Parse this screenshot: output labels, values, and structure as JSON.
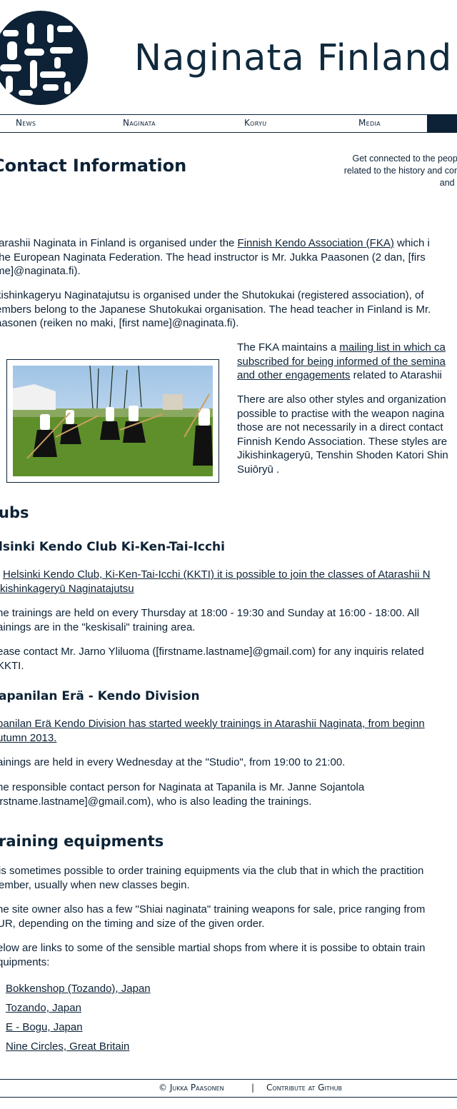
{
  "header": {
    "title": "Naginata Finland",
    "logo_icon": "naginata-kanji-logo"
  },
  "nav": {
    "items": [
      "News",
      "Naginata",
      "Koryu",
      "Media"
    ]
  },
  "page": {
    "title": "Contact Information",
    "intro": [
      "Get connected to the people wh",
      "related to the history and contents",
      "and to Na"
    ]
  },
  "p1": {
    "pre": "tarashii Naginata in Finland is organised under the ",
    "link": "Finnish Kendo Association (FKA)",
    "post": " which i",
    "line2": "the European Naginata Federation. The head instructor is Mr. Jukka Paasonen (2 dan, [firs",
    "line3": "me]@naginata.fi)."
  },
  "p2": {
    "line1": "kishinkageryu Naginatajutsu is organised under the Shutokukai (registered association), of",
    "line2": "embers belong to the Japanese Shutokukai organisation. The head teacher in Finland is Mr.",
    "line3": "aasonen (reiken no maki, [first name]@naginata.fi)."
  },
  "p3": {
    "pre": "The FKA maintains a ",
    "link1": "mailing list in which ca",
    "link2": "subscribed for being informed of the semina",
    "link3": "and other engagements",
    "post": " related to Atarashii"
  },
  "p4": [
    "There are also other styles and organization",
    "possible to practise with the weapon nagina",
    "those are not necessarily in a direct contact",
    "Finnish Kendo Association. These styles are",
    "Jikishinkageryū, Tenshin Shoden Katori Shin",
    "Suiōryū ."
  ],
  "photo": {
    "alt": "naginata training outdoors"
  },
  "clubs": {
    "title": "ubs",
    "kkti": {
      "title": "lsinki Kendo Club Ki-Ken-Tai-Icchi",
      "link_line1": "Helsinki Kendo Club, Ki-Ken-Tai-Icchi (KKTI) it is possible to join the classes of Atarashii N",
      "link_line2": "kishinkageryū Naginatajutsu",
      "p1_line1": "he trainings are held on every Thursday at 18:00 - 19:30 and Sunday at 16:00 - 18:00. All",
      "p1_line2": "ainings are in the \"keskisali\" training area.",
      "p2_line1": "ease contact Mr. Jarno Yliluoma ([firstname.lastname]@gmail.com) for any inquiris related",
      "p2_line2": "KKTI."
    },
    "tapanila": {
      "title": "apanilan Erä - Kendo Division",
      "link_line1": "panilan Erä Kendo Division has started weekly trainings in Atarashii Naginata, from beginn",
      "link_line2": "utumn 2013.",
      "p1": "ainings are held in every Wednesday at the \"Studio\", from 19:00 to 21:00.",
      "p2_line1": "he responsible contact person for Naginata at Tapanila is Mr. Janne Sojantola",
      "p2_line2": "irstname.lastname]@gmail.com), who is also leading the trainings."
    }
  },
  "equipment": {
    "title": "raining equipments",
    "p1_line1": "is sometimes possible to order training equipments via the club that in which the practition",
    "p1_line2": "ember, usually when new classes begin.",
    "p2_line1": "he site owner also has a few \"Shiai naginata\" training weapons for sale, price ranging from",
    "p2_line2": "UR, depending on the timing and size of the given order.",
    "p3_line1": "elow are links to some of the sensible martial shops from where it is possibe to obtain train",
    "p3_line2": "quipments:",
    "shops": [
      "Bokkenshop (Tozando), Japan",
      "Tozando, Japan",
      "E - Bogu, Japan",
      "Nine Circles, Great Britain"
    ]
  },
  "footer": {
    "copyright": "© Jukka Paasonen",
    "separator": "|",
    "contribute": "Contribute at Github"
  }
}
